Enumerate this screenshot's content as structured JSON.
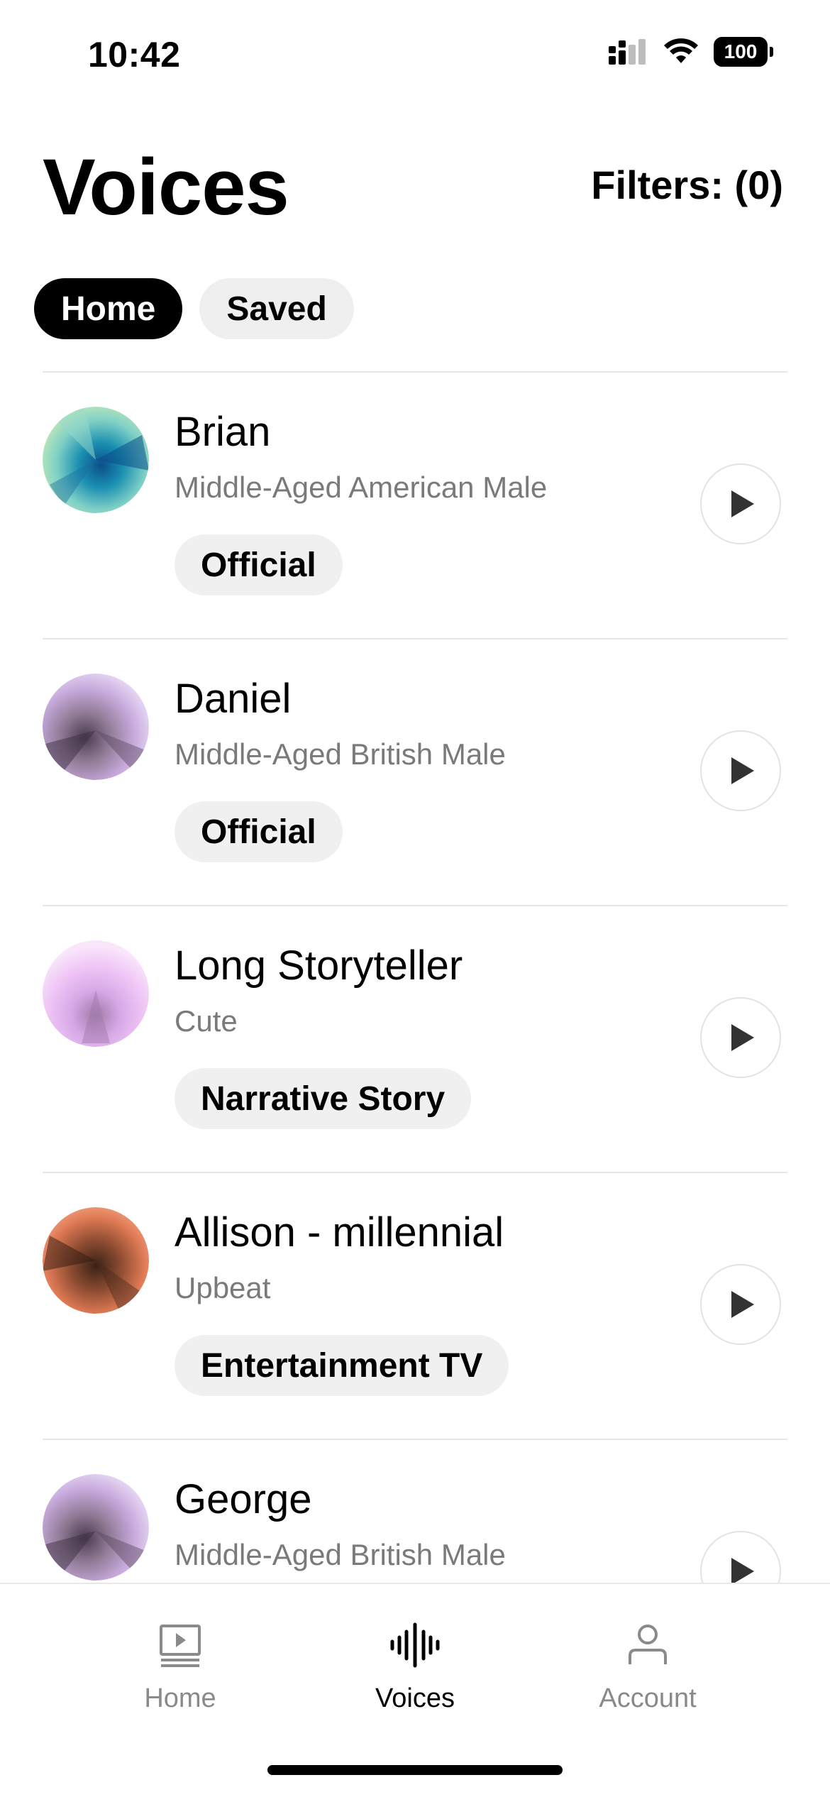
{
  "status_bar": {
    "time": "10:42",
    "battery": "100",
    "icons": [
      "signal-icon",
      "wifi-icon",
      "battery-icon"
    ]
  },
  "header": {
    "title": "Voices",
    "filters_label": "Filters: (0)"
  },
  "tabs": [
    {
      "label": "Home",
      "active": true
    },
    {
      "label": "Saved",
      "active": false
    }
  ],
  "voices": [
    {
      "name": "Brian",
      "description": "Middle-Aged American Male",
      "tag": "Official",
      "avatar_colors": [
        "#0b4f8a",
        "#1a8fb0",
        "#7fd0c6",
        "#bfe8b8"
      ]
    },
    {
      "name": "Daniel",
      "description": "Middle-Aged British Male",
      "tag": "Official",
      "avatar_colors": [
        "#4b3b4f",
        "#8f7a95",
        "#c6a9db",
        "#e8d8f6"
      ]
    },
    {
      "name": "Long Storyteller",
      "description": "Cute",
      "tag": "Narrative Story",
      "avatar_colors": [
        "#a07aa8",
        "#d6a8e6",
        "#efc6f6",
        "#f9e6fb"
      ]
    },
    {
      "name": "Allison - millennial",
      "description": "Upbeat",
      "tag": "Entertainment TV",
      "avatar_colors": [
        "#3a2218",
        "#8a4a30",
        "#e07a55",
        "#f6b08e"
      ]
    },
    {
      "name": "George",
      "description": "Middle-Aged British Male",
      "tag": "",
      "avatar_colors": [
        "#4b3b4f",
        "#8f7a95",
        "#c6a9db",
        "#e8d8f6"
      ]
    }
  ],
  "tab_bar": [
    {
      "label": "Home",
      "icon": "video-icon",
      "active": false
    },
    {
      "label": "Voices",
      "icon": "waveform-icon",
      "active": true
    },
    {
      "label": "Account",
      "icon": "person-icon",
      "active": false
    }
  ]
}
